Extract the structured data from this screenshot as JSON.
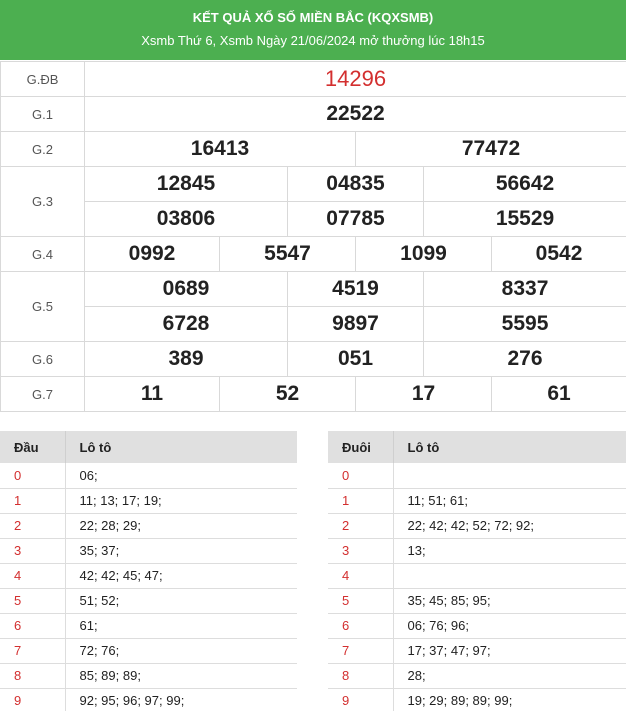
{
  "header": {
    "title": "KẾT QUẢ XỔ SỐ MIỀN BẮC (KQXSMB)",
    "subtitle": "Xsmb Thứ 6, Xsmb Ngày 21/06/2024 mở thưởng lúc 18h15"
  },
  "prizes": {
    "gdb": {
      "label": "G.ĐB",
      "numbers": [
        "14296"
      ]
    },
    "g1": {
      "label": "G.1",
      "numbers": [
        "22522"
      ]
    },
    "g2": {
      "label": "G.2",
      "numbers": [
        "16413",
        "77472"
      ]
    },
    "g3": {
      "label": "G.3",
      "numbers": [
        "12845",
        "04835",
        "56642",
        "03806",
        "07785",
        "15529"
      ]
    },
    "g4": {
      "label": "G.4",
      "numbers": [
        "0992",
        "5547",
        "1099",
        "0542"
      ]
    },
    "g5": {
      "label": "G.5",
      "numbers": [
        "0689",
        "4519",
        "8337",
        "6728",
        "9897",
        "5595"
      ]
    },
    "g6": {
      "label": "G.6",
      "numbers": [
        "389",
        "051",
        "276"
      ]
    },
    "g7": {
      "label": "G.7",
      "numbers": [
        "11",
        "52",
        "17",
        "61"
      ]
    }
  },
  "loto_dau": {
    "col_key": "Đầu",
    "col_val": "Lô tô",
    "rows": [
      {
        "key": "0",
        "val": "06;"
      },
      {
        "key": "1",
        "val": "11; 13; 17; 19;"
      },
      {
        "key": "2",
        "val": "22; 28; 29;"
      },
      {
        "key": "3",
        "val": "35; 37;"
      },
      {
        "key": "4",
        "val": "42; 42; 45; 47;"
      },
      {
        "key": "5",
        "val": "51; 52;"
      },
      {
        "key": "6",
        "val": "61;"
      },
      {
        "key": "7",
        "val": "72; 76;"
      },
      {
        "key": "8",
        "val": "85; 89; 89;"
      },
      {
        "key": "9",
        "val": "92; 95; 96; 97; 99;"
      }
    ]
  },
  "loto_duoi": {
    "col_key": "Đuôi",
    "col_val": "Lô tô",
    "rows": [
      {
        "key": "0",
        "val": ""
      },
      {
        "key": "1",
        "val": "11; 51; 61;"
      },
      {
        "key": "2",
        "val": "22; 42; 42; 52; 72; 92;"
      },
      {
        "key": "3",
        "val": "13;"
      },
      {
        "key": "4",
        "val": ""
      },
      {
        "key": "5",
        "val": "35; 45; 85; 95;"
      },
      {
        "key": "6",
        "val": "06; 76; 96;"
      },
      {
        "key": "7",
        "val": "17; 37; 47; 97;"
      },
      {
        "key": "8",
        "val": "28;"
      },
      {
        "key": "9",
        "val": "19; 29; 89; 89; 99;"
      }
    ]
  },
  "colors": {
    "header_bg": "#4caf50",
    "special_number": "#d32f2f",
    "loto_key": "#d32f2f"
  }
}
